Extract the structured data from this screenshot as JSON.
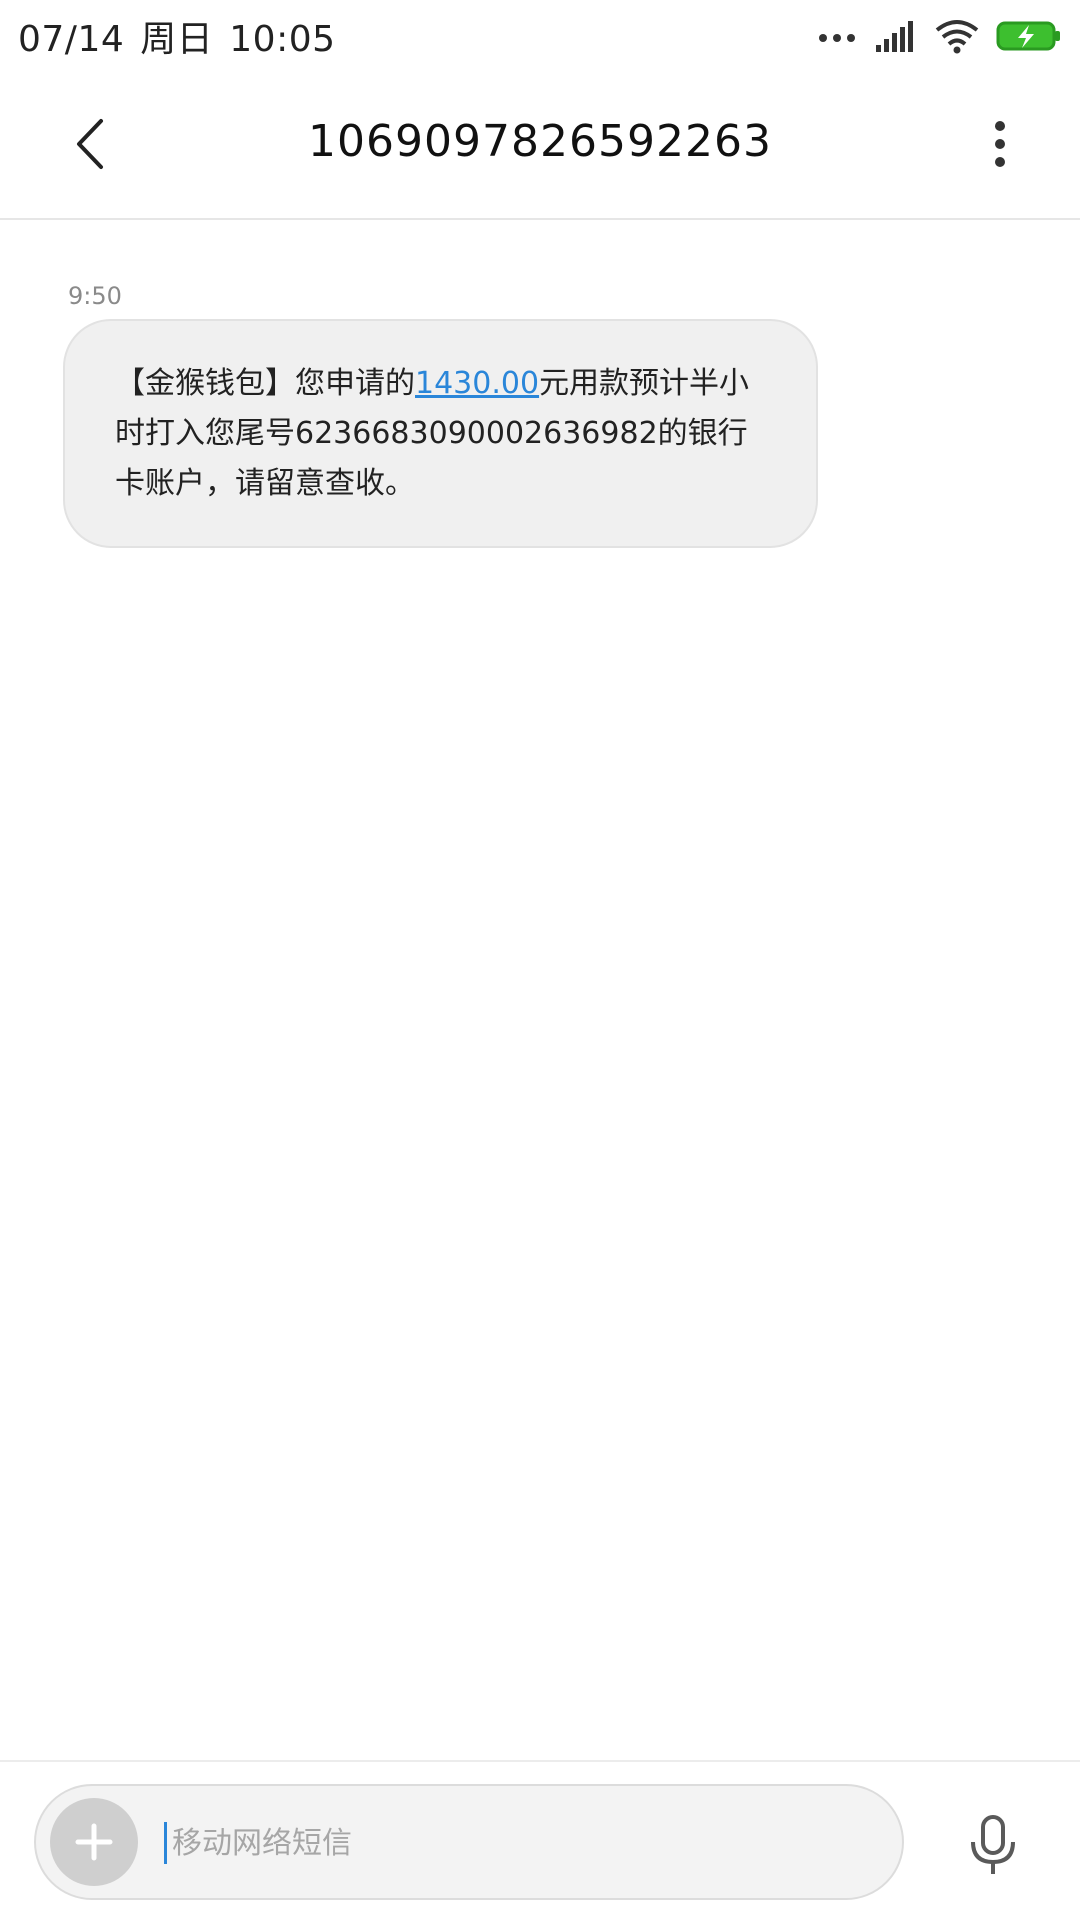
{
  "status_bar": {
    "date": "07/14",
    "weekday": "周日",
    "time": "10:05",
    "icons": [
      "more-dots-icon",
      "signal-icon",
      "wifi-icon",
      "battery-charging-icon"
    ],
    "battery_color": "#3dbf2f"
  },
  "header": {
    "title": "1069097826592263",
    "back_icon": "chevron-left-icon",
    "menu_icon": "more-vertical-icon"
  },
  "conversation": {
    "messages": [
      {
        "time": "9:50",
        "text_before": "【金猴钱包】您申请的",
        "amount_link": "1430.00",
        "text_after": "元用款预计半小时打入您尾号6236683090002636982的银行卡账户，请留意查收。"
      }
    ]
  },
  "composer": {
    "placeholder": "移动网络短信",
    "value": "",
    "attach_icon": "plus-icon",
    "voice_icon": "microphone-icon"
  },
  "colors": {
    "link": "#2a86d9",
    "bubble_bg": "#f0f0f0"
  }
}
